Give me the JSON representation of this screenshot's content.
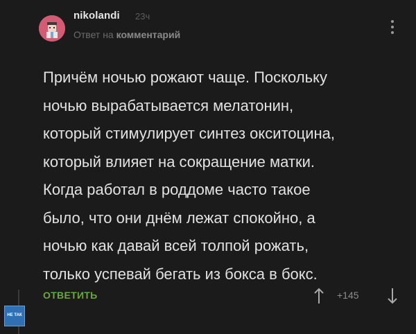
{
  "comment": {
    "username": "nikolandi",
    "time": "23ч",
    "reply_prefix": "Ответ на",
    "reply_link": "комментарий",
    "body_lines": [
      "Причём ночью рожают чаще. Поскольку",
      "ночью вырабатывается мелатонин,",
      "который стимулирует синтез окситоцина,",
      "который влияет на сокращение матки.",
      "Когда работал в роддоме часто такое",
      "было, что они днём лежат спокойно, а",
      "ночью как давай всей толпой рожать,",
      "только успевай бегать из бокса в бокс."
    ],
    "reply_button_label": "ОТВЕТИТЬ",
    "score": "+145"
  },
  "badge": {
    "text": "НЕ ТАК"
  },
  "icons": {
    "more": "more-vertical-icon",
    "upvote": "arrow-up-icon",
    "downvote": "arrow-down-icon"
  },
  "colors": {
    "background": "#1b1b1b",
    "text": "#e2e2e2",
    "accent_green": "#6aa83a",
    "avatar_bg": "#d35b73"
  }
}
